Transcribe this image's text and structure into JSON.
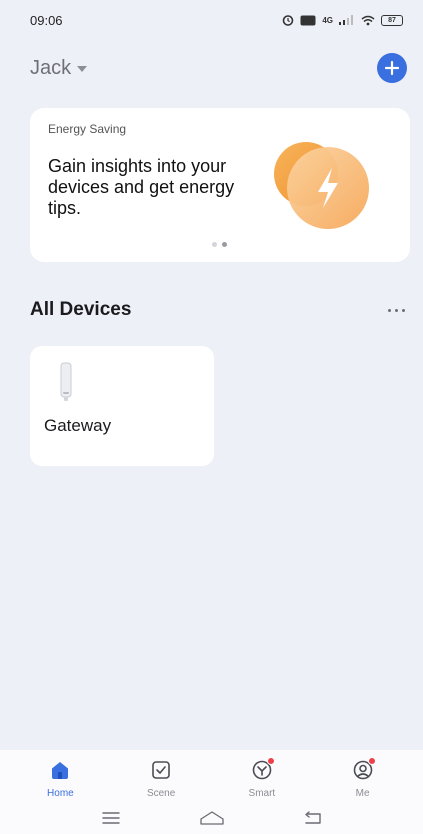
{
  "status_bar": {
    "time": "09:06",
    "network_label": "4G",
    "battery_label": "87"
  },
  "header": {
    "home_name": "Jack"
  },
  "energy_card": {
    "label": "Energy Saving",
    "headline": "Gain insights into your devices and get energy tips.",
    "carousel_pages": 2,
    "active_page": 2
  },
  "devices_section": {
    "title": "All Devices",
    "devices": [
      {
        "name": "Gateway",
        "icon": "gateway-icon"
      }
    ]
  },
  "tab_bar": {
    "tabs": [
      {
        "label": "Home",
        "icon": "home-icon",
        "active": true,
        "badge": false
      },
      {
        "label": "Scene",
        "icon": "scene-icon",
        "active": false,
        "badge": false
      },
      {
        "label": "Smart",
        "icon": "smart-icon",
        "active": false,
        "badge": true
      },
      {
        "label": "Me",
        "icon": "profile-icon",
        "active": false,
        "badge": true
      }
    ]
  },
  "colors": {
    "accent": "#3a6fe0",
    "background": "#eef0f7",
    "energy_orange": "#f5a24a",
    "badge_red": "#ee3f4b"
  }
}
